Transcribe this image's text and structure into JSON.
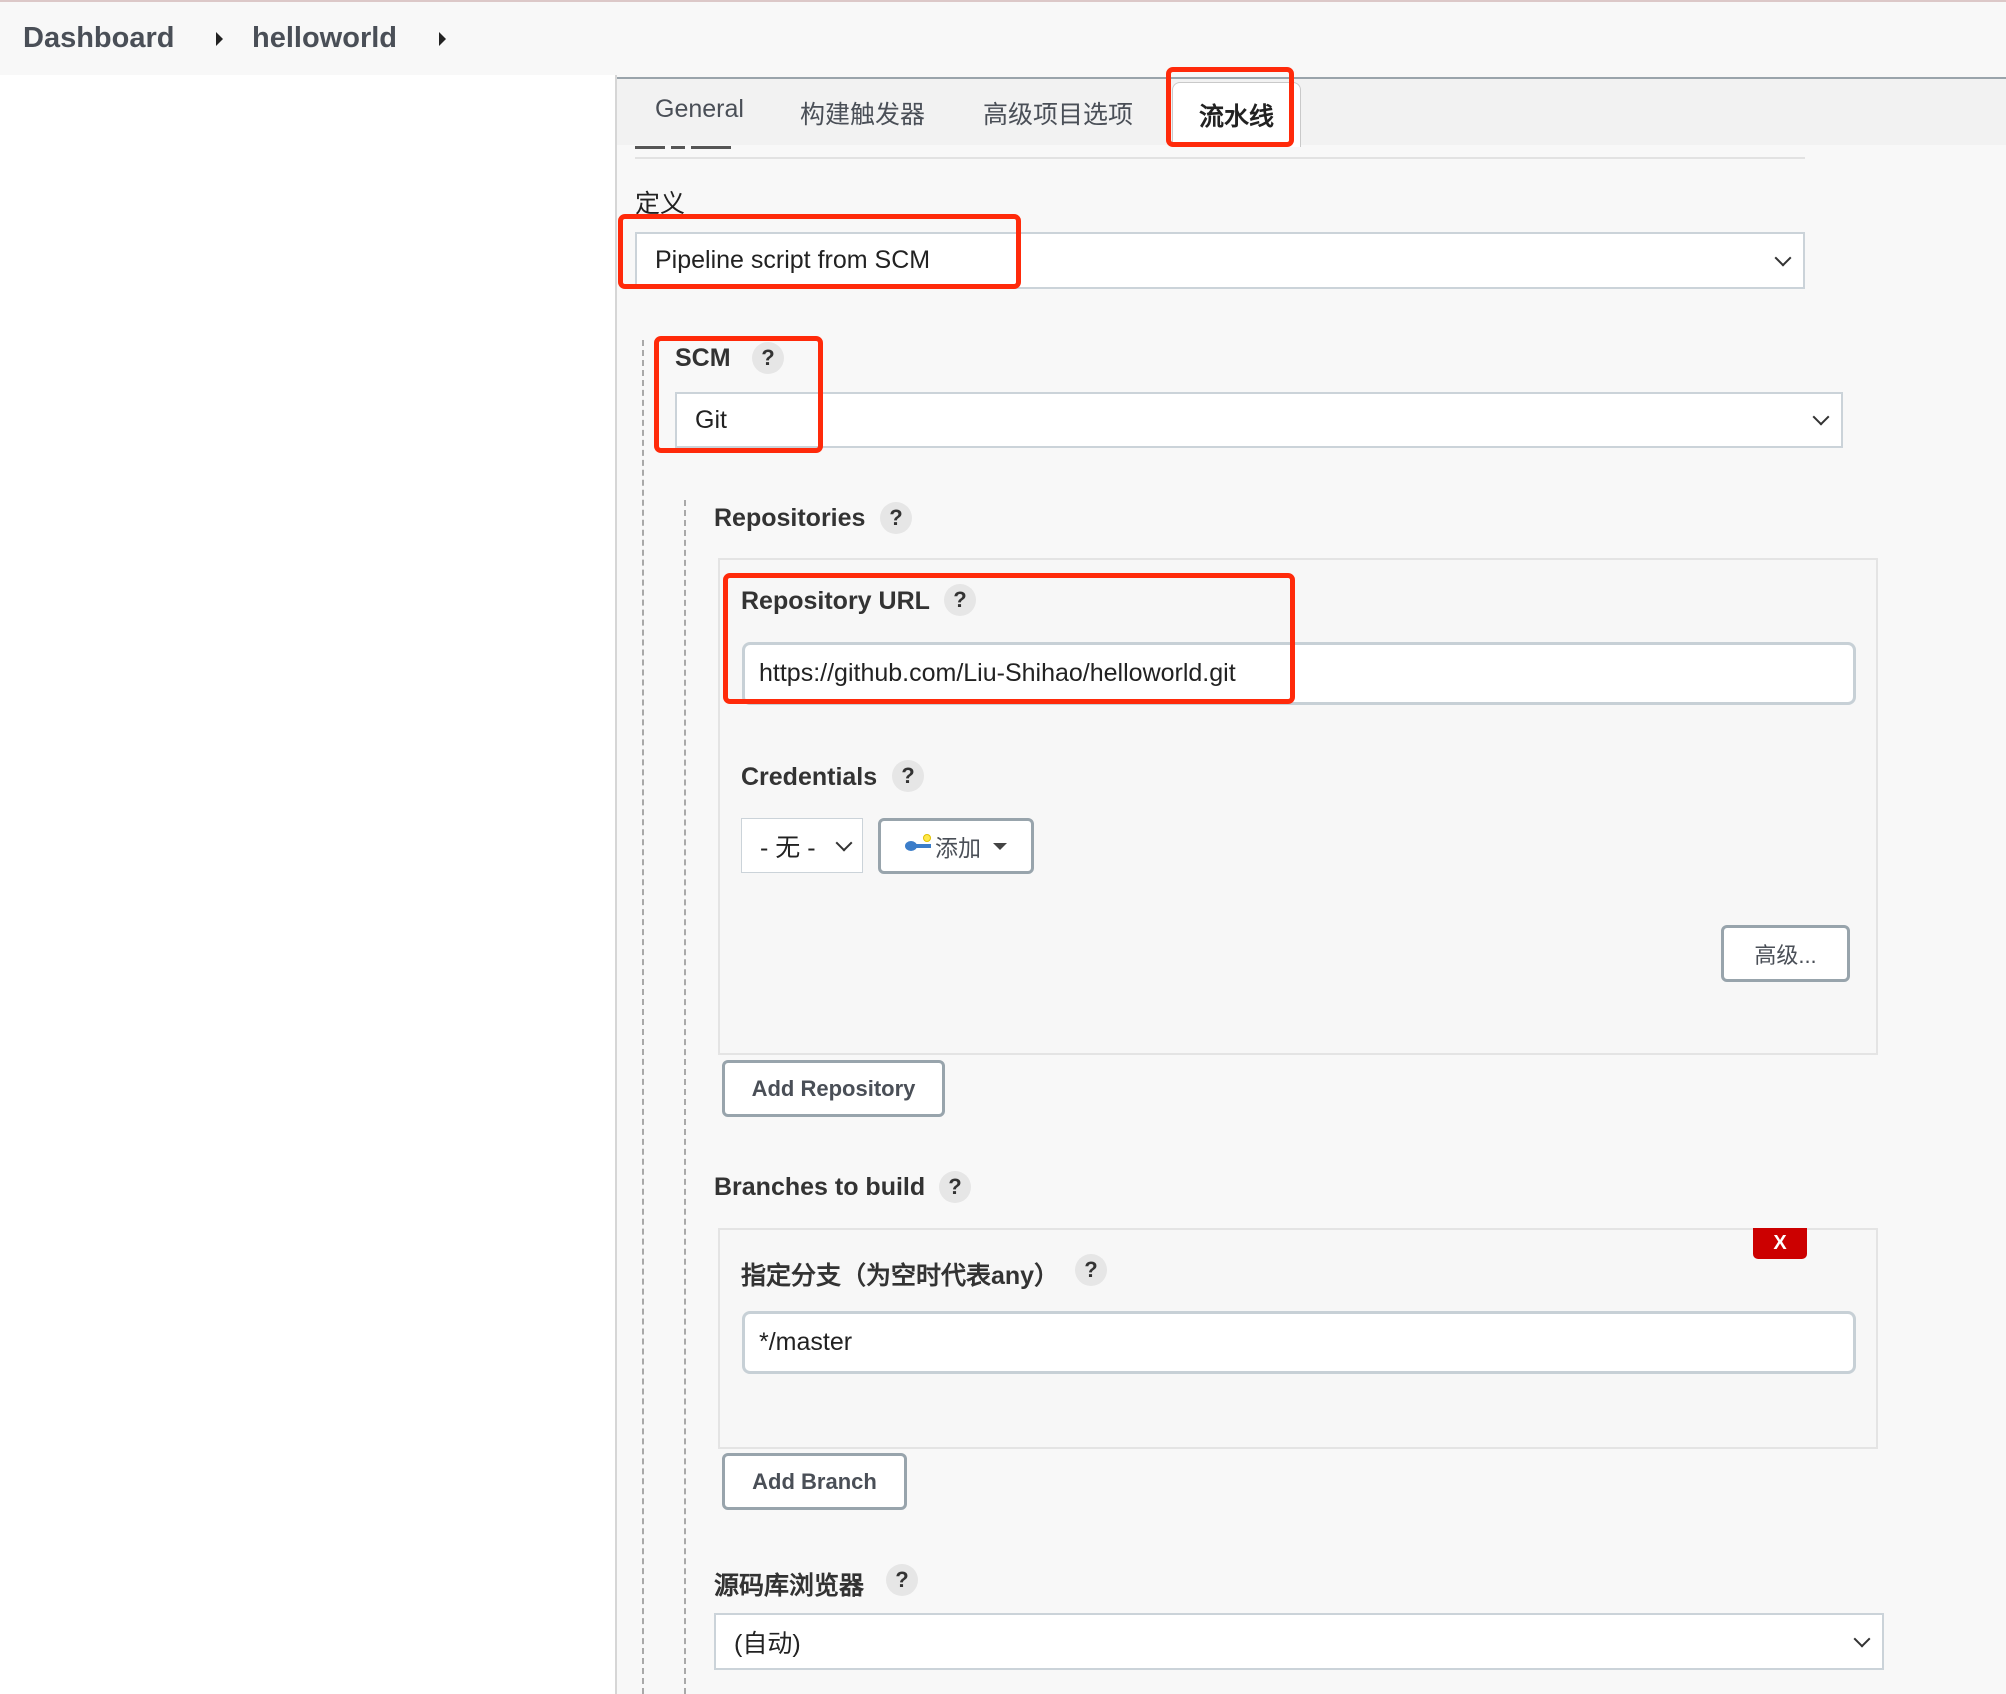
{
  "breadcrumb": {
    "items": [
      "Dashboard",
      "helloworld"
    ]
  },
  "tabs": [
    {
      "label": "General",
      "active": false
    },
    {
      "label": "构建触发器",
      "active": false
    },
    {
      "label": "高级项目选项",
      "active": false
    },
    {
      "label": "流水线",
      "active": true
    }
  ],
  "pipeline": {
    "definition_label": "定义",
    "definition_value": "Pipeline script from SCM",
    "scm_label": "SCM",
    "scm_value": "Git",
    "help_glyph": "?",
    "repositories_label": "Repositories",
    "repository_url_label": "Repository URL",
    "repository_url_value": "https://github.com/Liu-Shihao/helloworld.git",
    "credentials_label": "Credentials",
    "credentials_value": "- 无 -",
    "add_credentials_label": "添加",
    "advanced_label": "高级...",
    "add_repository_label": "Add Repository",
    "branches_label": "Branches to build",
    "branch_specifier_label": "指定分支（为空时代表any）",
    "branch_specifier_value": "*/master",
    "delete_branch_label": "X",
    "add_branch_label": "Add Branch",
    "repo_browser_label": "源码库浏览器",
    "repo_browser_value": "(自动)"
  },
  "highlight_color": "#ff2a0a"
}
